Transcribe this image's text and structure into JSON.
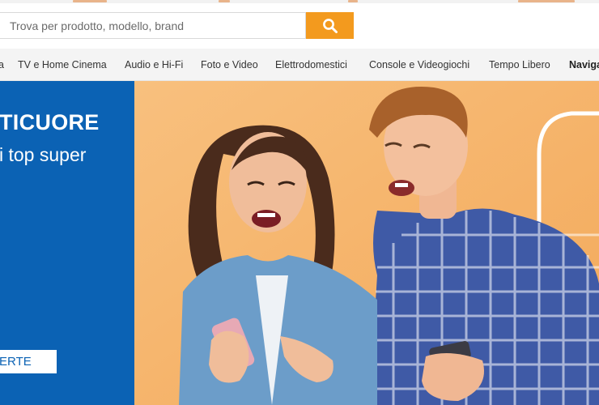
{
  "search": {
    "placeholder": "Trova per prodotto, modello, brand",
    "value": "",
    "button_icon": "search-icon"
  },
  "navbar": {
    "items": [
      {
        "label": "a"
      },
      {
        "label": "TV e Home Cinema"
      },
      {
        "label": "Audio e Hi-Fi"
      },
      {
        "label": "Foto e Video"
      },
      {
        "label": "Elettrodomestici"
      },
      {
        "label": "Console e Videogiochi"
      },
      {
        "label": "Tempo Libero"
      },
      {
        "label": "Naviga"
      }
    ]
  },
  "hero": {
    "title": "TICUORE",
    "subtitle": "i top super",
    "cta_label": "ERTE"
  },
  "colors": {
    "accent": "#f39a1e",
    "brand_blue": "#0b62b4",
    "hero_background": "#f6b468",
    "navbar": "#f4f4f4"
  }
}
